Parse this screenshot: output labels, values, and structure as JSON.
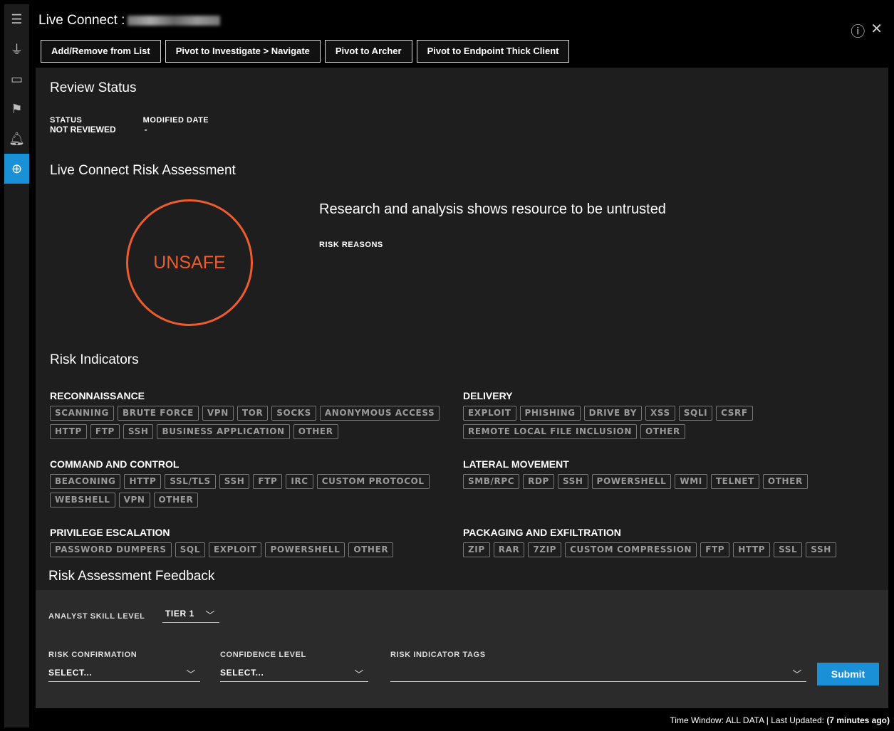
{
  "window": {
    "title": "Live Connect :",
    "help_icon": "help-circle-icon",
    "close_icon": "close-icon"
  },
  "sidebar": {
    "items": [
      {
        "name": "list-icon"
      },
      {
        "name": "pivot-icon"
      },
      {
        "name": "hosts-icon"
      },
      {
        "name": "flag-icon"
      },
      {
        "name": "alert-icon"
      },
      {
        "name": "globe-icon",
        "active": true
      }
    ]
  },
  "toolbar": {
    "add_remove": "Add/Remove from List",
    "pivot_investigate": "Pivot to Investigate > Navigate",
    "pivot_archer": "Pivot to Archer",
    "pivot_endpoint": "Pivot to Endpoint Thick Client"
  },
  "review": {
    "title": "Review Status",
    "status_label": "STATUS",
    "status_value": "NOT REVIEWED",
    "modified_label": "MODIFIED DATE",
    "modified_value": "-"
  },
  "assessment": {
    "title": "Live Connect Risk Assessment",
    "verdict": "UNSAFE",
    "verdict_color": "#ef5c2c",
    "headline": "Research and analysis shows resource to be untrusted",
    "reasons_label": "RISK REASONS"
  },
  "indicators": {
    "title": "Risk Indicators",
    "recon": {
      "name": "RECONNAISSANCE",
      "tags": [
        "SCANNING",
        "BRUTE FORCE",
        "VPN",
        "TOR",
        "SOCKS",
        "ANONYMOUS ACCESS",
        "HTTP",
        "FTP",
        "SSH",
        "BUSINESS APPLICATION",
        "OTHER"
      ]
    },
    "delivery": {
      "name": "DELIVERY",
      "tags": [
        "EXPLOIT",
        "PHISHING",
        "DRIVE BY",
        "XSS",
        "SQLI",
        "CSRF",
        "REMOTE LOCAL FILE INCLUSION",
        "OTHER"
      ]
    },
    "c2": {
      "name": "COMMAND AND CONTROL",
      "tags": [
        "BEACONING",
        "HTTP",
        "SSL/TLS",
        "SSH",
        "FTP",
        "IRC",
        "CUSTOM PROTOCOL",
        "WEBSHELL",
        "VPN",
        "OTHER"
      ]
    },
    "lateral": {
      "name": "LATERAL MOVEMENT",
      "tags": [
        "SMB/RPC",
        "RDP",
        "SSH",
        "POWERSHELL",
        "WMI",
        "TELNET",
        "OTHER"
      ]
    },
    "privesc": {
      "name": "PRIVILEGE ESCALATION",
      "tags": [
        "PASSWORD DUMPERS",
        "SQL",
        "EXPLOIT",
        "POWERSHELL",
        "OTHER"
      ]
    },
    "exfil": {
      "name": "PACKAGING AND EXFILTRATION",
      "tags": [
        "ZIP",
        "RAR",
        "7ZIP",
        "CUSTOM COMPRESSION",
        "FTP",
        "HTTP",
        "SSL",
        "SSH"
      ]
    }
  },
  "feedback": {
    "title": "Risk Assessment Feedback",
    "skill_label": "ANALYST SKILL LEVEL",
    "skill_value": "TIER 1",
    "confirmation_label": "RISK CONFIRMATION",
    "confirmation_value": "SELECT...",
    "confidence_label": "CONFIDENCE LEVEL",
    "confidence_value": "SELECT...",
    "tags_label": "RISK INDICATOR TAGS",
    "tags_value": "",
    "submit": "Submit",
    "accent": "#1a91d6"
  },
  "footer": {
    "text": "Time Window: ALL DATA | Last Updated:",
    "updated": "(7 minutes ago)"
  }
}
